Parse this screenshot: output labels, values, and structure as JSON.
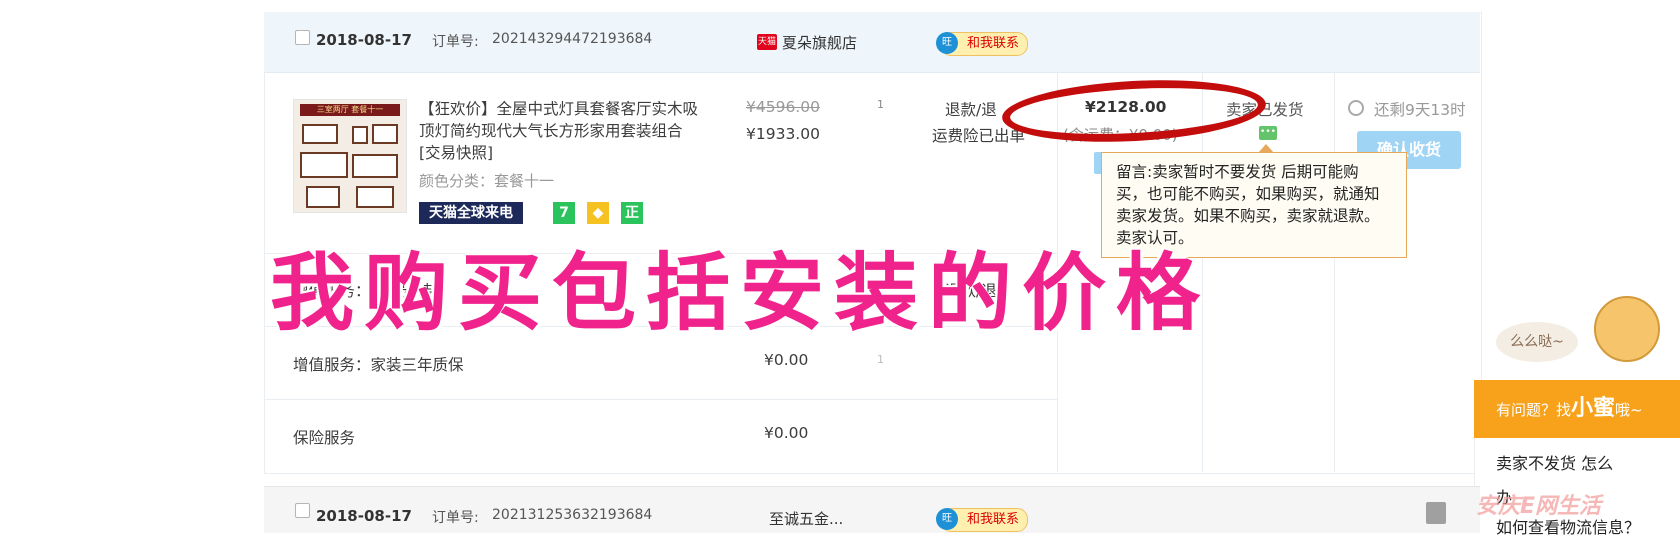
{
  "order1": {
    "date": "2018-08-17",
    "order_no_label": "订单号:",
    "order_no": "202143294472193684",
    "shop_tag": "天猫",
    "shop_name": "夏朵旗舰店",
    "contact_label": "和我联系",
    "product": {
      "title_line1": "【狂欢价】全屋中式灯具套餐客厅实木吸",
      "title_line2": "顶灯简约现代大气长方形家用套装组合",
      "snapshot": "[交易快照]",
      "color_label": "颜色分类：套餐十一",
      "thumb_banner": "三室两厅 套餐十一",
      "badge_tmall": "天猫全球来电",
      "badge_7": "7",
      "badge_zheng": "正",
      "price_original": "¥4596.00",
      "price": "¥1933.00",
      "quantity": "1",
      "refund": "退款/退",
      "insurance": "运费险已出单"
    },
    "total": "¥2128.00",
    "shipping": "(含运费：¥0.00)",
    "status": "卖家已发货",
    "timer": "还剩9天13时",
    "confirm_label": "确认收货",
    "message": {
      "line1": "留言:卖家暂时不要发货  后期可能购",
      "line2": "买，也可能不购买，如果购买，就通知",
      "line3": "卖家发货。如果不购买，卖家就退款。",
      "line4": "卖家认可。"
    },
    "services": [
      {
        "label": "增值服务：上门安装",
        "price": "¥195.00",
        "refund": "退款/退"
      },
      {
        "label": "增值服务：家装三年质保",
        "price": "¥0.00",
        "quantity": "1"
      },
      {
        "label": "保险服务",
        "price": "¥0.00"
      }
    ]
  },
  "overlay_text": "我购买包括安装的价格",
  "help": {
    "bubble": "么么哒~",
    "header_prefix": "有问题？找",
    "header_name": "小蜜",
    "header_suffix": "哦~",
    "q1": "卖家不发货  怎么",
    "q2": "办",
    "q3": "如何查看物流信息？"
  },
  "order2": {
    "date": "2018-08-17",
    "order_no_label": "订单号:",
    "order_no": "202131253632193684",
    "shop_name": "至诚五金...",
    "contact_label": "和我联系"
  },
  "watermark": "安庆E网生活"
}
